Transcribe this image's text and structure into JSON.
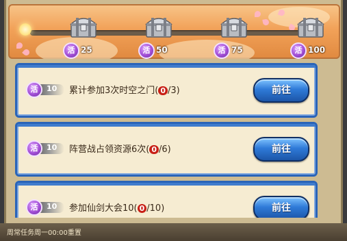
{
  "activity_progress": {
    "fill_fraction": 0.0,
    "milestones": [
      {
        "badge": "活",
        "points": "25",
        "icon": "silver-chest-icon"
      },
      {
        "badge": "活",
        "points": "50",
        "icon": "silver-chest-icon"
      },
      {
        "badge": "活",
        "points": "75",
        "icon": "silver-chest-icon"
      },
      {
        "badge": "活",
        "points": "100",
        "icon": "silver-chest-icon"
      }
    ]
  },
  "tasks": [
    {
      "badge": "活",
      "reward": "10",
      "text_before": "累计参加3次时空之门(",
      "current": "0",
      "text_after": "/3)",
      "button": "前往"
    },
    {
      "badge": "活",
      "reward": "10",
      "text_before": "阵营战占领资源6次(",
      "current": "0",
      "text_after": "/6)",
      "button": "前往"
    },
    {
      "badge": "活",
      "reward": "10",
      "text_before": "参加仙剑大会10(",
      "current": "0",
      "text_after": "/10)",
      "button": "前往"
    }
  ],
  "footer": {
    "text": "周常任务周一00:00重置"
  },
  "colors": {
    "accent": "#2a64b8",
    "badge": "#a24fd6",
    "progress_current": "#c81f16"
  }
}
